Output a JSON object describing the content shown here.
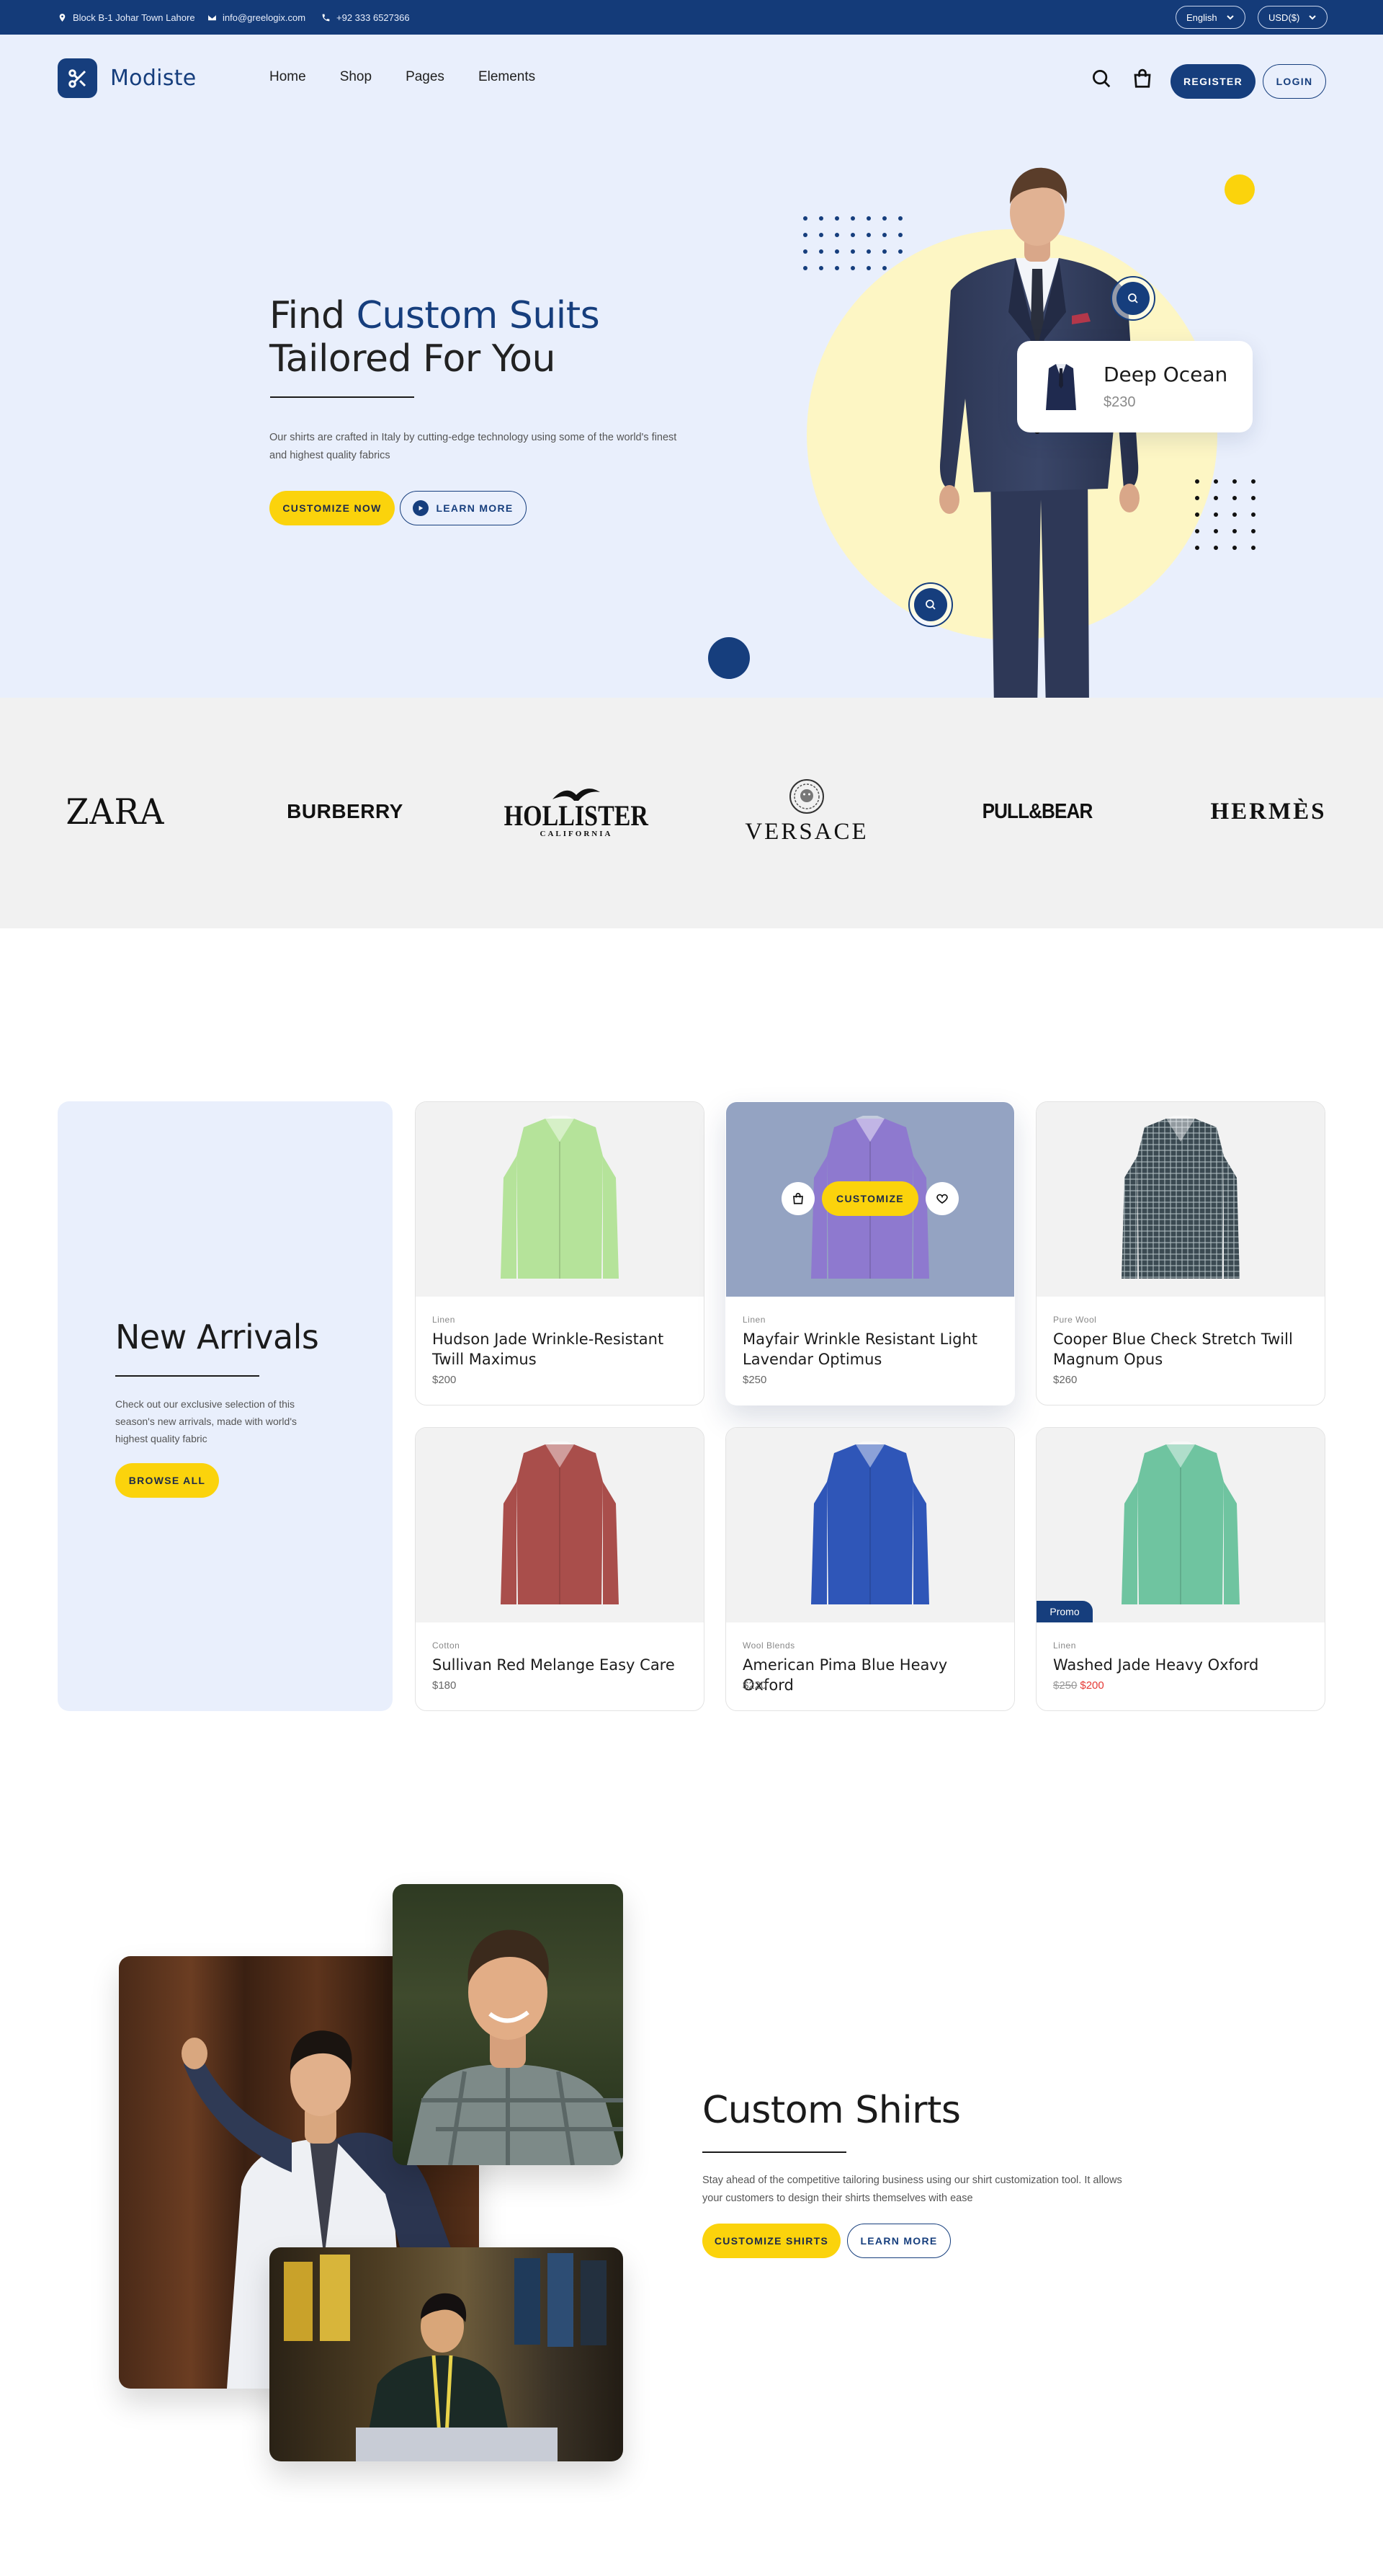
{
  "topbar": {
    "address": "Block B-1 Johar Town Lahore",
    "email": "info@greelogix.com",
    "phone": "+92 333 6527366",
    "language": "English",
    "currency": "USD($)"
  },
  "header": {
    "logo": "Modiste",
    "nav": [
      "Home",
      "Shop",
      "Pages",
      "Elements"
    ],
    "register": "REGISTER",
    "login": "LOGIN",
    "icons": [
      "search-icon",
      "bag-icon"
    ]
  },
  "hero": {
    "title_prefix": "Find ",
    "title_accent": "Custom Suits",
    "title_line2": "Tailored For You",
    "lead": "Our shirts are crafted in Italy by cutting-edge technology using some of the world's finest and highest quality fabrics",
    "cta_primary": "CUSTOMIZE NOW",
    "cta_secondary": "LEARN MORE",
    "card_name": "Deep Ocean",
    "card_price": "$230"
  },
  "brands": [
    "ZARA",
    "BURBERRY",
    "HOLLISTER",
    "CALIFORNIA",
    "VERSACE",
    "PULL&BEAR",
    "HERMÈS"
  ],
  "arrivals": {
    "title": "New Arrivals",
    "text": "Check out our exclusive selection of this season's new arrivals, made with world's highest quality fabric",
    "cta": "BROWSE ALL",
    "hover_cta": "CUSTOMIZE",
    "promo_label": "Promo",
    "products": [
      {
        "category": "Linen",
        "name": "Hudson Jade Wrinkle-Resistant Twill Maximus",
        "price": "$200",
        "color": "#b5e39a"
      },
      {
        "category": "Linen",
        "name": "Mayfair Wrinkle Resistant Light Lavendar Optimus",
        "price": "$250",
        "color": "#8e79cf"
      },
      {
        "category": "Pure Wool",
        "name": "Cooper Blue Check Stretch Twill Magnum Opus",
        "price": "$260",
        "color": "#3b4a52"
      },
      {
        "category": "Cotton",
        "name": "Sullivan Red Melange Easy Care",
        "price": "$180",
        "color": "#a94e4b"
      },
      {
        "category": "Wool Blends",
        "name": "American Pima Blue Heavy Oxford",
        "price": "$220",
        "color": "#2f56b8"
      },
      {
        "category": "Linen",
        "name": "Washed Jade Heavy Oxford",
        "price_old": "$250",
        "price": "$200",
        "color": "#6fc4a0"
      }
    ]
  },
  "custom_shirts": {
    "title": "Custom Shirts",
    "text": "Stay ahead of the competitive tailoring business using our shirt customization tool. It allows your customers to design their shirts themselves with ease",
    "cta_primary": "CUSTOMIZE SHIRTS",
    "cta_secondary": "LEARN MORE"
  }
}
